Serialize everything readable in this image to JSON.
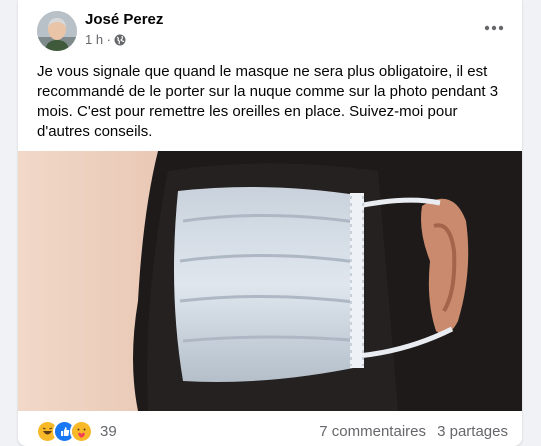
{
  "post": {
    "author": "José Perez",
    "time": "1 h ·",
    "text": "Je vous signale que quand le masque ne sera plus obligatoire, il est recommandé de le porter sur la nuque comme sur la photo pendant 3 mois. C'est pour remettre les oreilles en place. Suivez-moi pour d'autres conseils.",
    "privacy_icon": "globe-icon",
    "more_icon": "more-horizontal-icon"
  },
  "stats": {
    "reaction_icons": [
      "haha-reaction-icon",
      "like-reaction-icon",
      "care-reaction-icon"
    ],
    "reaction_count": "39",
    "comments": "7 commentaires",
    "shares": "3 partages"
  },
  "colors": {
    "background": "#f0f2f5",
    "text_primary": "#050505",
    "text_secondary": "#65676b",
    "like_blue": "#1877f2",
    "reaction_yellow": "#f7b928"
  }
}
